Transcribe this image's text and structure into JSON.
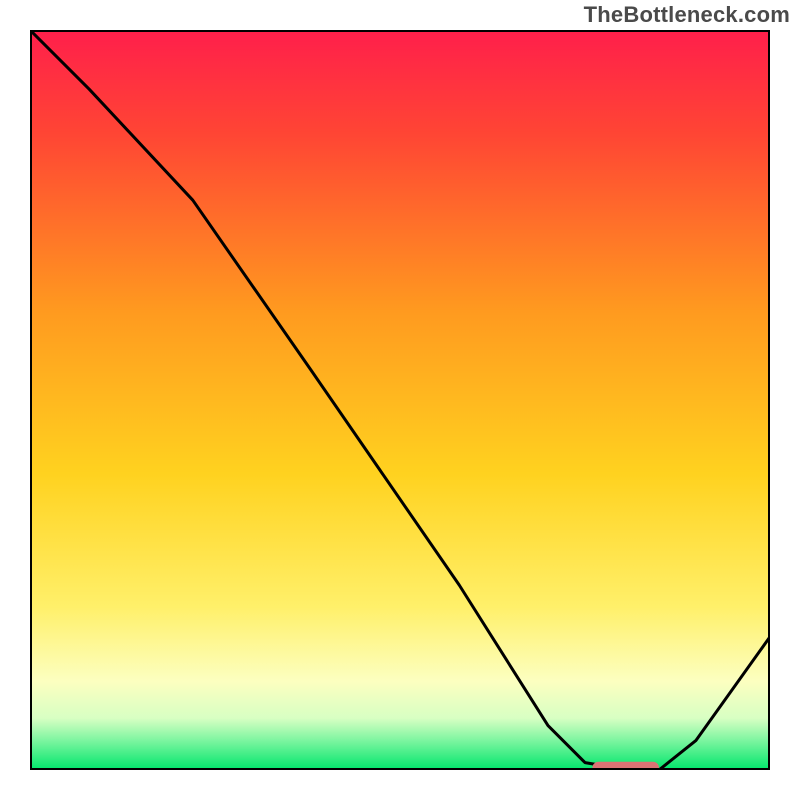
{
  "watermark": "TheBottleneck.com",
  "colors": {
    "gradient_top": "#ff1f4b",
    "gradient_upper": "#ff6a2a",
    "gradient_mid": "#ffd21f",
    "gradient_lower_yellow": "#fff79a",
    "gradient_pale": "#f4ffe0",
    "gradient_green": "#00e66b",
    "curve": "#000000",
    "marker_fill": "#db7374",
    "frame": "#000000"
  },
  "chart_data": {
    "type": "line",
    "title": "",
    "xlabel": "",
    "ylabel": "",
    "xlim": [
      0,
      100
    ],
    "ylim": [
      0,
      100
    ],
    "grid": false,
    "legend": false,
    "series": [
      {
        "name": "bottleneck-curve",
        "x": [
          0,
          8,
          22,
          38,
          58,
          70,
          75,
          81,
          85,
          90,
          100
        ],
        "values": [
          100,
          92,
          77,
          54,
          25,
          6,
          1,
          0,
          0,
          4,
          18
        ]
      }
    ],
    "marker": {
      "name": "optimal-region",
      "x_start": 76,
      "x_end": 85,
      "y": 0.3
    },
    "gradient_stops_pct": [
      {
        "offset": 0,
        "color": "#ff1f4b"
      },
      {
        "offset": 14,
        "color": "#ff4534"
      },
      {
        "offset": 38,
        "color": "#ff9a1f"
      },
      {
        "offset": 60,
        "color": "#ffd21f"
      },
      {
        "offset": 78,
        "color": "#fff06a"
      },
      {
        "offset": 88,
        "color": "#fcffc0"
      },
      {
        "offset": 93,
        "color": "#d8ffc3"
      },
      {
        "offset": 96,
        "color": "#7df5a0"
      },
      {
        "offset": 100,
        "color": "#00e66b"
      }
    ]
  }
}
